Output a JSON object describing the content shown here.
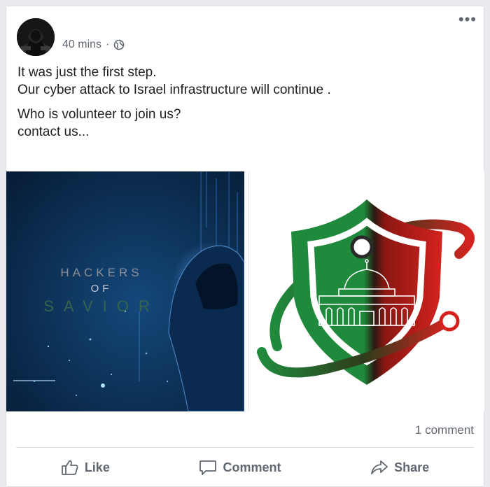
{
  "post": {
    "time": "40 mins",
    "separator": "·",
    "privacy_icon": "globe-icon",
    "more_icon": "more-options-icon",
    "more_label": "•••",
    "text_lines": [
      "It was just the first step.",
      "Our cyber attack to Israel infrastructure will continue .",
      "Who is volunteer to join us?",
      "contact us..."
    ]
  },
  "left_image": {
    "line1": "HACKERS",
    "line2": "OF",
    "line3": "SAVIOR"
  },
  "footer": {
    "comment_count": "1 comment",
    "like_label": "Like",
    "comment_label": "Comment",
    "share_label": "Share"
  },
  "colors": {
    "text": "#1c1e21",
    "muted": "#606770",
    "shield_green": "#1f8a3c",
    "shield_red": "#d4231f"
  }
}
